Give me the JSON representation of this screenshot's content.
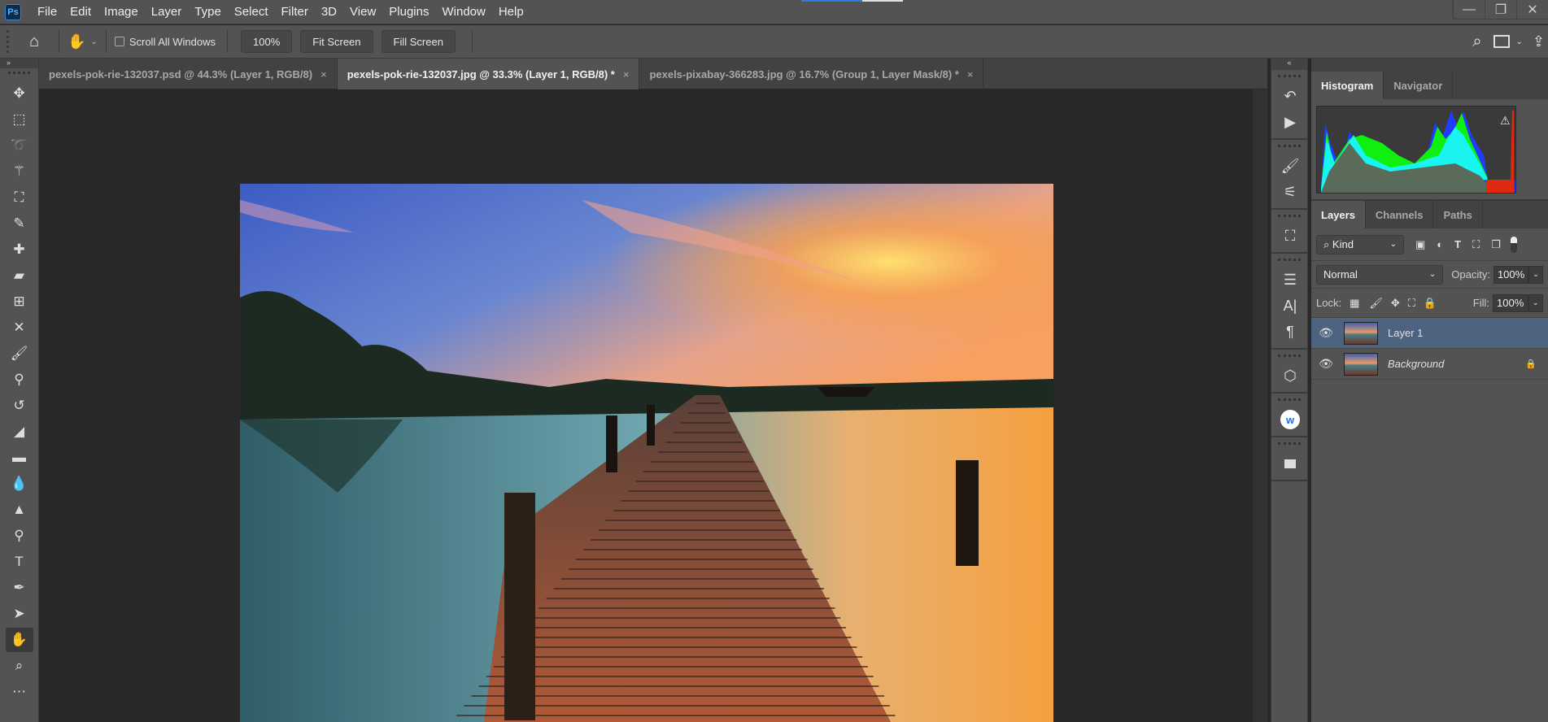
{
  "app": {
    "logo": "Ps"
  },
  "menu": [
    "File",
    "Edit",
    "Image",
    "Layer",
    "Type",
    "Select",
    "Filter",
    "3D",
    "View",
    "Plugins",
    "Window",
    "Help"
  ],
  "window_controls": {
    "minimize": "—",
    "restore": "❐",
    "close": "✕"
  },
  "options": {
    "scroll_all_windows_label": "Scroll All Windows",
    "scroll_all_windows_checked": false,
    "zoom_100": "100%",
    "fit_screen": "Fit Screen",
    "fill_screen": "Fill Screen"
  },
  "tabs": [
    {
      "label": "pexels-pok-rie-132037.psd @ 44.3% (Layer 1, RGB/8)",
      "active": false
    },
    {
      "label": "pexels-pok-rie-132037.jpg @ 33.3% (Layer 1, RGB/8) *",
      "active": true
    },
    {
      "label": "pexels-pixabay-366283.jpg @ 16.7% (Group 1, Layer Mask/8) *",
      "active": false
    }
  ],
  "tools": [
    "move",
    "rectangular-marquee",
    "lasso",
    "magic-wand",
    "crop",
    "eyedropper",
    "spot-healing",
    "bandage",
    "content-aware-move",
    "recompose",
    "brush",
    "clone-stamp",
    "history-brush",
    "eraser",
    "gradient",
    "blur",
    "sharpen",
    "dodge",
    "type",
    "pen",
    "path-selection",
    "hand",
    "zoom",
    "more"
  ],
  "active_tool": "hand",
  "histogram_panel": {
    "tabs": [
      "Histogram",
      "Navigator"
    ],
    "active": "Histogram",
    "warning": "cache-warning"
  },
  "layers_panel": {
    "tabs": [
      "Layers",
      "Channels",
      "Paths"
    ],
    "active": "Layers",
    "filter_kind": "Kind",
    "blend_mode": "Normal",
    "opacity_label": "Opacity:",
    "opacity": "100%",
    "lock_label": "Lock:",
    "fill_label": "Fill:",
    "fill": "100%",
    "layers": [
      {
        "name": "Layer 1",
        "visible": true,
        "selected": true,
        "locked": false
      },
      {
        "name": "Background",
        "visible": true,
        "selected": false,
        "locked": true
      }
    ]
  },
  "colors": {
    "accent": "#2d7de0",
    "panel": "#535353",
    "canvas": "#282828",
    "selected_layer": "#4d6380"
  }
}
